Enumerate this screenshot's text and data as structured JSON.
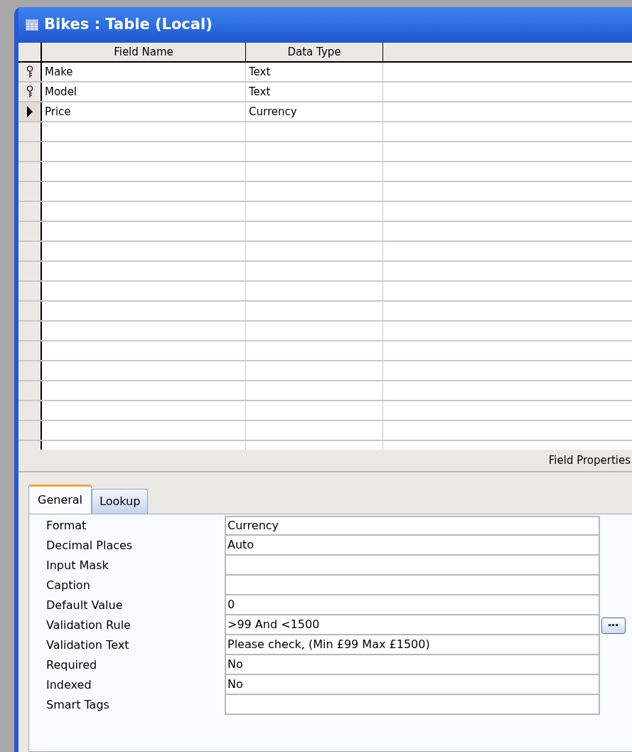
{
  "window": {
    "title": "Bikes : Table (Local)"
  },
  "grid": {
    "columns": [
      "Field Name",
      "Data Type"
    ],
    "rows": [
      {
        "field_name": "Make",
        "data_type": "Text",
        "primary_key": true,
        "selected": false
      },
      {
        "field_name": "Model",
        "data_type": "Text",
        "primary_key": true,
        "selected": false
      },
      {
        "field_name": "Price",
        "data_type": "Currency",
        "selected": true
      }
    ]
  },
  "field_properties": {
    "title": "Field Properties",
    "tabs": [
      {
        "label": "General",
        "selected": true
      },
      {
        "label": "Lookup",
        "selected": false
      }
    ],
    "properties": [
      {
        "label": "Format",
        "value": "Currency"
      },
      {
        "label": "Decimal Places",
        "value": "Auto"
      },
      {
        "label": "Input Mask"
      },
      {
        "label": "Caption"
      },
      {
        "label": "Default Value",
        "value": "0"
      },
      {
        "label": "Validation Rule",
        "value": ">99 And <1500",
        "builder": true
      },
      {
        "label": "Validation Text",
        "value": "Please check, (Min £99 Max £1500)"
      },
      {
        "label": "Required",
        "value": "No"
      },
      {
        "label": "Indexed",
        "value": "No"
      },
      {
        "label": "Smart Tags"
      }
    ]
  }
}
